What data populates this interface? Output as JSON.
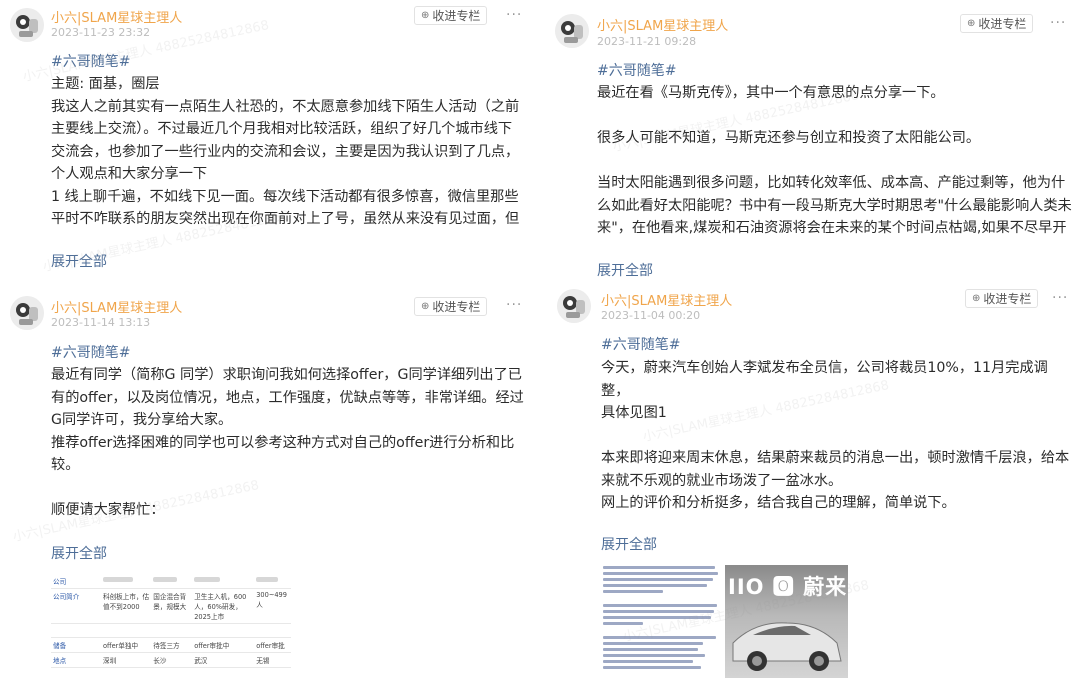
{
  "posts": [
    {
      "author": "小六|SLAM星球主理人",
      "date": "2023-11-23 23:32",
      "collect_label": "收进专栏",
      "more_label": "···",
      "tag": "#六哥随笔#",
      "lines": [
        "主题: 面基，圈层",
        "我这人之前其实有一点陌生人社恐的，不太愿意参加线下陌生人活动（之前",
        "主要线上交流）。不过最近几个月我相对比较活跃，组织了好几个城市线下",
        "交流会，也参加了一些行业内的交流和会议，主要是因为我认识到了几点，",
        "个人观点和大家分享一下",
        "1 线上聊千遍，不如线下见一面。每次线下活动都有很多惊喜，微信里那些",
        "平时不咋联系的朋友突然出现在你面前对上了号，虽然从来没有见过面，但"
      ],
      "expand_label": "展开全部"
    },
    {
      "author": "小六|SLAM星球主理人",
      "date": "2023-11-14 13:13",
      "collect_label": "收进专栏",
      "more_label": "···",
      "tag": "#六哥随笔#",
      "lines": [
        "最近有同学（简称G 同学）求职询问我如何选择offer，G同学详细列出了已",
        "有的offer，以及岗位情况，地点，工作强度，优缺点等等，非常详细。经过",
        "G同学许可，我分享给大家。",
        "推荐offer选择困难的同学也可以参考这种方式对自己的offer进行分析和比",
        "较。",
        "",
        "顺便请大家帮忙："
      ],
      "expand_label": "展开全部",
      "table_image": {
        "rows": [
          {
            "key": "公司",
            "cells": [
              "",
              "",
              "",
              ""
            ]
          },
          {
            "key": "公司简介",
            "cells": [
              "科创板上市，估值不到2000",
              "国企混合背景，规模大",
              "卫生主入机，600人，60%研发，2025上市",
              "300~499人"
            ]
          },
          {
            "key": "",
            "cells": [
              "",
              "",
              "",
              ""
            ]
          },
          {
            "key": "储备",
            "cells": [
              "offer单独中",
              "待签三方",
              "offer审批中",
              "offer审批"
            ]
          },
          {
            "key": "地点",
            "cells": [
              "深圳",
              "长沙",
              "武汉",
              "无锡"
            ]
          }
        ]
      }
    },
    {
      "author": "小六|SLAM星球主理人",
      "date": "2023-11-21 09:28",
      "collect_label": "收进专栏",
      "more_label": "···",
      "tag": "#六哥随笔#",
      "lines": [
        "最近在看《马斯克传》，其中一个有意思的点分享一下。",
        "",
        "很多人可能不知道，马斯克还参与创立和投资了太阳能公司。",
        "",
        "当时太阳能遇到很多问题，比如转化效率低、成本高、产能过剩等，他为什",
        "么如此看好太阳能呢？书中有一段马斯克大学时期思考\"什么最能影响人类未",
        "来\"，在他看来,煤炭和石油资源将会在未来的某个时间点枯竭,如果不尽早开"
      ],
      "expand_label": "展开全部"
    },
    {
      "author": "小六|SLAM星球主理人",
      "date": "2023-11-04 00:20",
      "collect_label": "收进专栏",
      "more_label": "···",
      "tag": "#六哥随笔#",
      "lines": [
        "今天，蔚来汽车创始人李斌发布全员信，公司将裁员10%，11月完成调整，",
        "具体见图1",
        "",
        "本来即将迎来周末休息，结果蔚来裁员的消息一出，顿时激情千层浪，给本",
        "来就不乐观的就业市场泼了一盆冰水。",
        "网上的评价和分析挺多，结合我自己的理解，简单说下。"
      ],
      "expand_label": "展开全部",
      "article_image": {
        "logo_text": "IIO 🅾 蔚来"
      }
    }
  ],
  "watermark_text": "小六|SLAM星球主理人 48825284812868"
}
